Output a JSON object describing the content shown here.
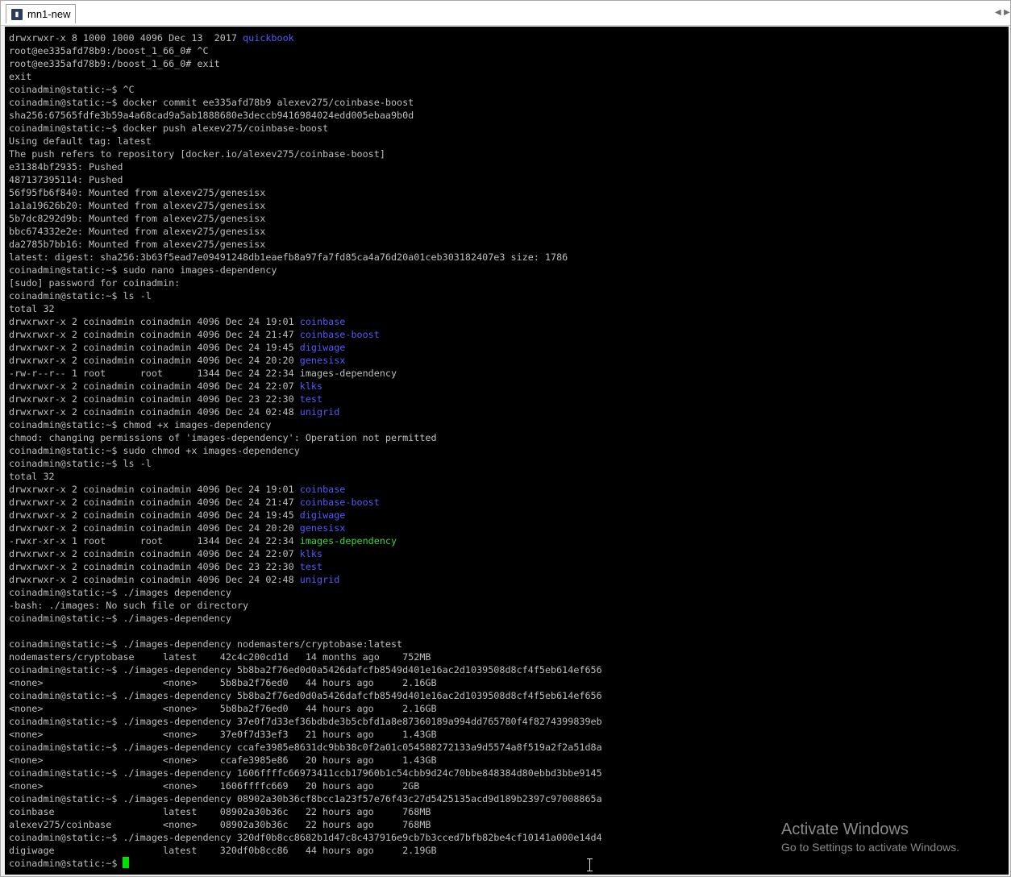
{
  "tab": {
    "label": "mn1-new",
    "icon": "putty-terminal-icon"
  },
  "colors": {
    "directory": "#5757ff",
    "executable": "#33dd33",
    "text": "#bfbfbf",
    "cursor": "#00e000"
  },
  "terminal": {
    "lines": [
      {
        "text": "drwxrwxr-x 8 1000 1000 4096 Dec 13  2017 ",
        "hl": "quickbook",
        "hlclass": "dir"
      },
      {
        "text": "root@ee335afd78b9:/boost_1_66_0# ^C"
      },
      {
        "text": "root@ee335afd78b9:/boost_1_66_0# exit"
      },
      {
        "text": "exit"
      },
      {
        "text": "coinadmin@static:~$ ^C"
      },
      {
        "text": "coinadmin@static:~$ docker commit ee335afd78b9 alexev275/coinbase-boost"
      },
      {
        "text": "sha256:67565fdfe3b59a4a68cad9a5ab1888680e3deccb9416984024edd005ebaa9b0d"
      },
      {
        "text": "coinadmin@static:~$ docker push alexev275/coinbase-boost"
      },
      {
        "text": "Using default tag: latest"
      },
      {
        "text": "The push refers to repository [docker.io/alexev275/coinbase-boost]"
      },
      {
        "text": "e31384bf2935: Pushed"
      },
      {
        "text": "487137395114: Pushed"
      },
      {
        "text": "56f95fb6f840: Mounted from alexev275/genesisx"
      },
      {
        "text": "1a1a19626b20: Mounted from alexev275/genesisx"
      },
      {
        "text": "5b7dc8292d9b: Mounted from alexev275/genesisx"
      },
      {
        "text": "bbc674332e2e: Mounted from alexev275/genesisx"
      },
      {
        "text": "da2785b7bb16: Mounted from alexev275/genesisx"
      },
      {
        "text": "latest: digest: sha256:3b63f5ead7e09491248db1eaefb8a97fa7fd85ca4a76d20a01ceb303182407e3 size: 1786"
      },
      {
        "text": "coinadmin@static:~$ sudo nano images-dependency"
      },
      {
        "text": "[sudo] password for coinadmin:"
      },
      {
        "text": "coinadmin@static:~$ ls -l"
      },
      {
        "text": "total 32"
      },
      {
        "text": "drwxrwxr-x 2 coinadmin coinadmin 4096 Dec 24 19:01 ",
        "hl": "coinbase",
        "hlclass": "dir"
      },
      {
        "text": "drwxrwxr-x 2 coinadmin coinadmin 4096 Dec 24 21:47 ",
        "hl": "coinbase-boost",
        "hlclass": "dir"
      },
      {
        "text": "drwxrwxr-x 2 coinadmin coinadmin 4096 Dec 24 19:45 ",
        "hl": "digiwage",
        "hlclass": "dir"
      },
      {
        "text": "drwxrwxr-x 2 coinadmin coinadmin 4096 Dec 24 20:20 ",
        "hl": "genesisx",
        "hlclass": "dir"
      },
      {
        "text": "-rw-r--r-- 1 root      root      1344 Dec 24 22:34 images-dependency"
      },
      {
        "text": "drwxrwxr-x 2 coinadmin coinadmin 4096 Dec 24 22:07 ",
        "hl": "klks",
        "hlclass": "dir"
      },
      {
        "text": "drwxrwxr-x 2 coinadmin coinadmin 4096 Dec 23 22:30 ",
        "hl": "test",
        "hlclass": "dir"
      },
      {
        "text": "drwxrwxr-x 2 coinadmin coinadmin 4096 Dec 24 02:48 ",
        "hl": "unigrid",
        "hlclass": "dir"
      },
      {
        "text": "coinadmin@static:~$ chmod +x images-dependency"
      },
      {
        "text": "chmod: changing permissions of 'images-dependency': Operation not permitted"
      },
      {
        "text": "coinadmin@static:~$ sudo chmod +x images-dependency"
      },
      {
        "text": "coinadmin@static:~$ ls -l"
      },
      {
        "text": "total 32"
      },
      {
        "text": "drwxrwxr-x 2 coinadmin coinadmin 4096 Dec 24 19:01 ",
        "hl": "coinbase",
        "hlclass": "dir"
      },
      {
        "text": "drwxrwxr-x 2 coinadmin coinadmin 4096 Dec 24 21:47 ",
        "hl": "coinbase-boost",
        "hlclass": "dir"
      },
      {
        "text": "drwxrwxr-x 2 coinadmin coinadmin 4096 Dec 24 19:45 ",
        "hl": "digiwage",
        "hlclass": "dir"
      },
      {
        "text": "drwxrwxr-x 2 coinadmin coinadmin 4096 Dec 24 20:20 ",
        "hl": "genesisx",
        "hlclass": "dir"
      },
      {
        "text": "-rwxr-xr-x 1 root      root      1344 Dec 24 22:34 ",
        "hl": "images-dependency",
        "hlclass": "exec"
      },
      {
        "text": "drwxrwxr-x 2 coinadmin coinadmin 4096 Dec 24 22:07 ",
        "hl": "klks",
        "hlclass": "dir"
      },
      {
        "text": "drwxrwxr-x 2 coinadmin coinadmin 4096 Dec 23 22:30 ",
        "hl": "test",
        "hlclass": "dir"
      },
      {
        "text": "drwxrwxr-x 2 coinadmin coinadmin 4096 Dec 24 02:48 ",
        "hl": "unigrid",
        "hlclass": "dir"
      },
      {
        "text": "coinadmin@static:~$ ./images dependency"
      },
      {
        "text": "-bash: ./images: No such file or directory"
      },
      {
        "text": "coinadmin@static:~$ ./images-dependency"
      },
      {
        "text": ""
      },
      {
        "text": "coinadmin@static:~$ ./images-dependency nodemasters/cryptobase:latest"
      },
      {
        "text": "nodemasters/cryptobase     latest    42c4c200cd1d   14 months ago    752MB"
      },
      {
        "text": "coinadmin@static:~$ ./images-dependency 5b8ba2f76ed0d0a5426dafcfb8549d401e16ac2d1039508d8cf4f5eb614ef656"
      },
      {
        "text": "<none>                     <none>    5b8ba2f76ed0   44 hours ago     2.16GB"
      },
      {
        "text": "coinadmin@static:~$ ./images-dependency 5b8ba2f76ed0d0a5426dafcfb8549d401e16ac2d1039508d8cf4f5eb614ef656"
      },
      {
        "text": "<none>                     <none>    5b8ba2f76ed0   44 hours ago     2.16GB"
      },
      {
        "text": "coinadmin@static:~$ ./images-dependency 37e0f7d33ef36bdbde3b5cbfd1a8e87360189a994dd765780f4f8274399839eb"
      },
      {
        "text": "<none>                     <none>    37e0f7d33ef3   21 hours ago     1.43GB"
      },
      {
        "text": "coinadmin@static:~$ ./images-dependency ccafe3985e8631dc9bb38c0f2a01c054588272133a9d5574a8f519a2f2a51d8a"
      },
      {
        "text": "<none>                     <none>    ccafe3985e86   20 hours ago     1.43GB"
      },
      {
        "text": "coinadmin@static:~$ ./images-dependency 1606ffffc66973411ccb17960b1c54cbb9d24c70bbe848384d80ebbd3bbe9145"
      },
      {
        "text": "<none>                     <none>    1606ffffc669   20 hours ago     2GB"
      },
      {
        "text": "coinadmin@static:~$ ./images-dependency 08902a30b36cf8bcc1a23f57e76f43c27d5425135acd9d189b2397c97008865a"
      },
      {
        "text": "coinbase                   latest    08902a30b36c   22 hours ago     768MB"
      },
      {
        "text": "alexev275/coinbase         <none>    08902a30b36c   22 hours ago     768MB"
      },
      {
        "text": "coinadmin@static:~$ ./images-dependency 320df0b8cc8682b1d47c8c437916e9cb7b3cced7bfb82be4cf10141a000e14d4"
      },
      {
        "text": "digiwage                   latest    320df0b8cc86   44 hours ago     2.19GB"
      },
      {
        "text": "coinadmin@static:~$ ",
        "cursor": true
      }
    ]
  },
  "watermark": {
    "title": "Activate Windows",
    "subtitle": "Go to Settings to activate Windows."
  }
}
